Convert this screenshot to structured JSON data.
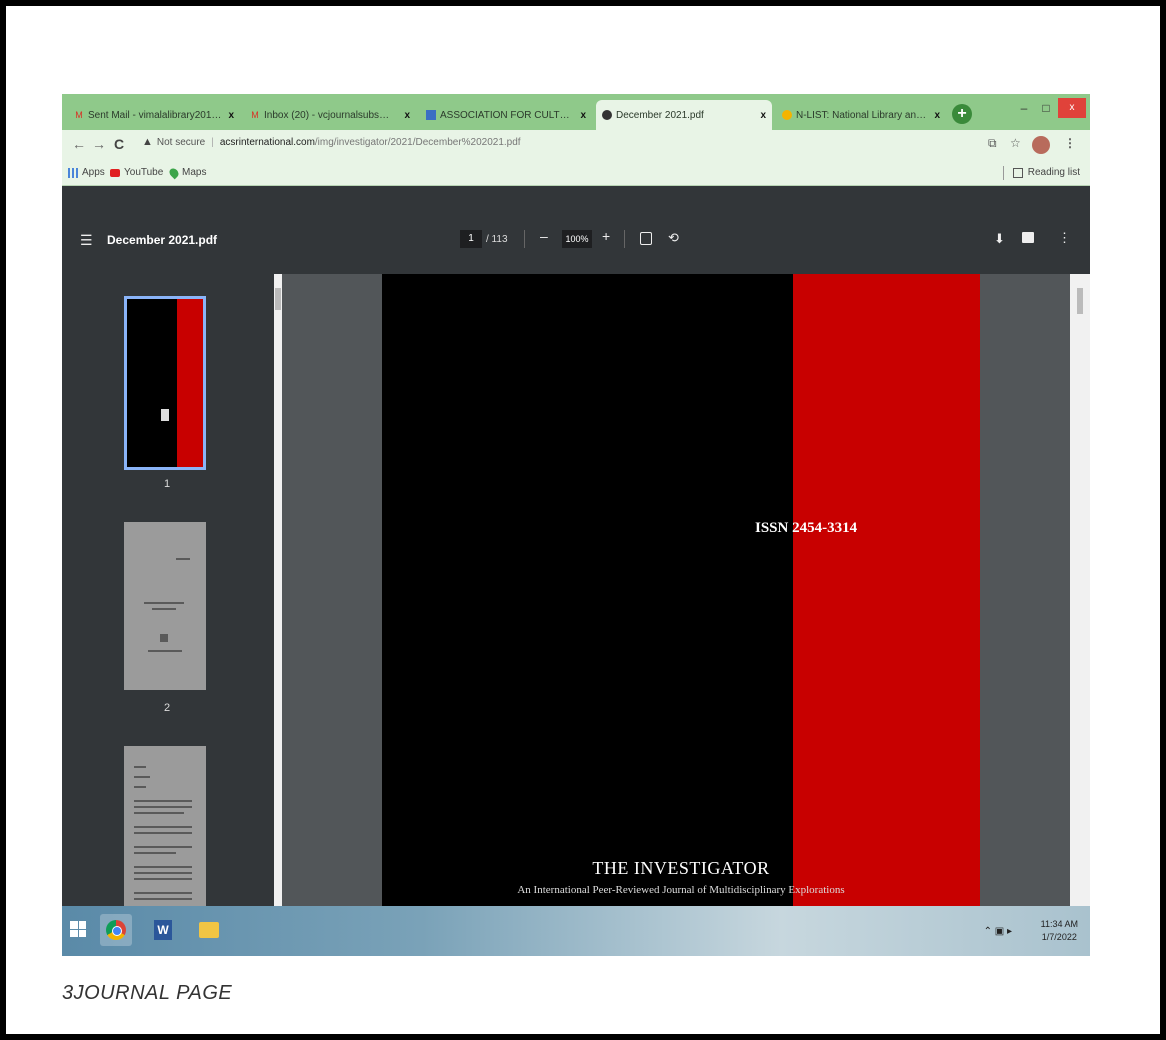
{
  "browser": {
    "tabs": [
      {
        "label": "Sent Mail - vimalalibrary20150",
        "favicon": "gmail-icon",
        "close": "x"
      },
      {
        "label": "Inbox (20) - vcjournalsubs@gm",
        "favicon": "gmail-icon",
        "close": "x"
      },
      {
        "label": "ASSOCIATION FOR CULTURAL",
        "favicon": "acs-icon",
        "close": "x"
      },
      {
        "label": "December 2021.pdf",
        "favicon": "globe-icon",
        "close": "x",
        "active": true
      },
      {
        "label": "N-LIST: National Library and In",
        "favicon": "nlist-icon",
        "close": "x"
      }
    ],
    "new_tab": "+",
    "window_controls": {
      "minimize": "–",
      "maximize": "□",
      "close": "x"
    },
    "address": {
      "security": "Not secure",
      "host": "acsrinternational.com",
      "path": "/img/investigator/2021/December%202021.pdf"
    },
    "bookmarks": [
      {
        "label": "Apps",
        "icon": "apps-grid-icon"
      },
      {
        "label": "YouTube",
        "icon": "youtube-icon"
      },
      {
        "label": "Maps",
        "icon": "maps-pin-icon"
      }
    ],
    "reading_list": "Reading list"
  },
  "pdf": {
    "title": "December 2021.pdf",
    "page_current": "1",
    "page_total": "/ 113",
    "zoom": "100%",
    "zoom_out": "–",
    "zoom_in": "+",
    "thumb_numbers": [
      "1",
      "2"
    ]
  },
  "document": {
    "issn": "ISSN 2454-3314",
    "journal_title": "THE INVESTIGATOR",
    "journal_subtitle": "An International Peer-Reviewed Journal of Multidisciplinary Explorations",
    "colors": {
      "left_panel": "#000000",
      "right_band": "#c80000"
    }
  },
  "taskbar": {
    "clock_time": "11:34 AM",
    "clock_date": "1/7/2022"
  },
  "caption": "3JOURNAL PAGE"
}
